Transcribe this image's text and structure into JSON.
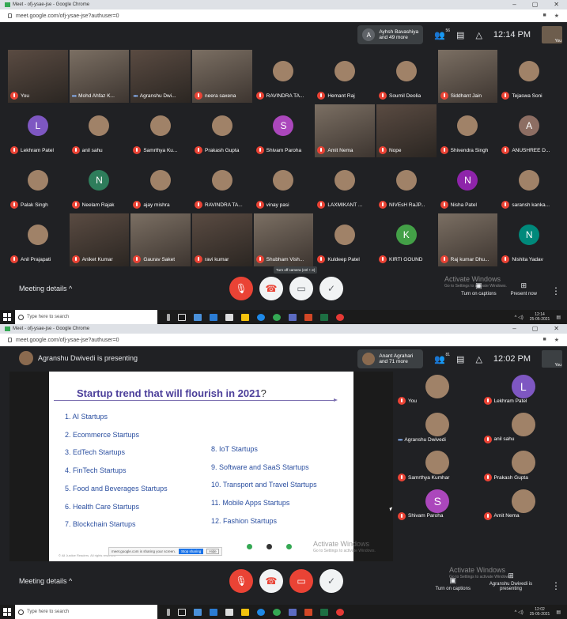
{
  "colors": {
    "meet_bg": "#202124",
    "mic_off": "#ea4335",
    "accent_blue": "#1a73e8",
    "slide_title": "#4c3f9a",
    "slide_item": "#2b4fa0"
  },
  "top": {
    "tab_title": "Meet - ofj-ysae-jse - Google Chrome",
    "url": "meet.google.com/ofj-ysae-jse?authuser=0",
    "pill_initial": "A",
    "pill_text": "Ayhsh Bavashiya and 49 more",
    "people_count": "56",
    "clock": "12:14 PM",
    "self_label": "You",
    "tiles": [
      {
        "name": "You",
        "muted": true,
        "kind": "video"
      },
      {
        "name": "Mohd Ahfaz K...",
        "muted": false,
        "kind": "video2"
      },
      {
        "name": "Agranshu Dwi...",
        "muted": false,
        "kind": "video"
      },
      {
        "name": "neera saxena",
        "muted": true,
        "kind": "video2"
      },
      {
        "name": "RAVINDRA TA...",
        "muted": true,
        "kind": "photo"
      },
      {
        "name": "Hemant Raj",
        "muted": true,
        "kind": "photo"
      },
      {
        "name": "Soumil Deolia",
        "muted": true,
        "kind": "photo"
      },
      {
        "name": "Siddhant Jain",
        "muted": true,
        "kind": "video2"
      },
      {
        "name": "Tejaswa Soni",
        "muted": true,
        "kind": "photo"
      },
      {
        "name": "Lekhram Patel",
        "muted": true,
        "initial": "L",
        "color": "#7e57c2"
      },
      {
        "name": "anil sahu",
        "muted": true,
        "kind": "photo"
      },
      {
        "name": "Samrthya Ku...",
        "muted": true,
        "kind": "photo"
      },
      {
        "name": "Prakash Gupta",
        "muted": true,
        "kind": "photo"
      },
      {
        "name": "Shivam Paroha",
        "muted": true,
        "initial": "S",
        "color": "#ab47bc"
      },
      {
        "name": "Amit Nema",
        "muted": true,
        "kind": "video2"
      },
      {
        "name": "Nope",
        "muted": true,
        "kind": "video"
      },
      {
        "name": "Shivendra Singh",
        "muted": true,
        "kind": "photo"
      },
      {
        "name": "ANUSHREE D...",
        "muted": true,
        "initial": "A",
        "color": "#8d6e63"
      },
      {
        "name": "Palak Singh",
        "muted": true,
        "kind": "photo"
      },
      {
        "name": "Neelam Rajak",
        "muted": true,
        "initial": "N",
        "color": "#2e7d5b"
      },
      {
        "name": "ajay mishra",
        "muted": true,
        "kind": "photo"
      },
      {
        "name": "RAVINDRA TA...",
        "muted": true,
        "kind": "photo"
      },
      {
        "name": "vinay pasi",
        "muted": true,
        "kind": "photo"
      },
      {
        "name": "LAXMIKANT ...",
        "muted": true,
        "kind": "photo"
      },
      {
        "name": "NIVEsH RaJP...",
        "muted": true,
        "kind": "photo"
      },
      {
        "name": "Nisha Patel",
        "muted": true,
        "initial": "N",
        "color": "#8e24aa"
      },
      {
        "name": "saransh kanka...",
        "muted": true,
        "kind": "photo"
      },
      {
        "name": "Anil Prajapati",
        "muted": true,
        "kind": "photo"
      },
      {
        "name": "Aniket Kumar",
        "muted": true,
        "kind": "video"
      },
      {
        "name": "Gaurav Saket",
        "muted": true,
        "kind": "video2"
      },
      {
        "name": "ravi kumar",
        "muted": true,
        "kind": "video"
      },
      {
        "name": "Shubham Vish...",
        "muted": true,
        "kind": "video2"
      },
      {
        "name": "Kuldeep Patel",
        "muted": true,
        "kind": "photo"
      },
      {
        "name": "KIRTI GOUND",
        "muted": true,
        "initial": "K",
        "color": "#43a047"
      },
      {
        "name": "Raj kumar Dhu...",
        "muted": true,
        "kind": "video2"
      },
      {
        "name": "Nishita Yadav",
        "muted": true,
        "initial": "N",
        "color": "#00897b"
      }
    ],
    "meeting_details": "Meeting details",
    "tooltip": "Turn off camera (ctrl + e)",
    "captions": "Turn on captions",
    "present": "Present now",
    "watermark_title": "Activate Windows",
    "watermark_sub": "Go to Settings to activate Windows.",
    "taskbar_search": "Type here to search",
    "tray_time": "12:14",
    "tray_date": "25-05-2021"
  },
  "bottom": {
    "tab_title": "Meet - ofj-ysae-jse - Google Chrome",
    "url": "meet.google.com/ofj-ysae-jse?authuser=0",
    "presenting": "Agranshu Dwivedi is presenting",
    "pill_text": "Anant Agrahari and 71 more",
    "people_count": "81",
    "clock": "12:02 PM",
    "self_label": "You",
    "slide": {
      "title": "Startup trend  that will flourish in 2021",
      "qmark": "?",
      "left_items": [
        "1. AI Startups",
        "2. Ecommerce Startups",
        "3. EdTech Startups",
        "4. FinTech Startups",
        "5. Food and Beverages Startups",
        "6. Health Care Startups",
        "7. Blockchain Startups"
      ],
      "right_items": [
        "8. IoT Startups",
        "9. Software and SaaS Startups",
        "10. Transport and Travel Startups",
        "11. Mobile Apps Startups",
        "12. Fashion Startups"
      ],
      "copyright": "© All Justice Readers. All rights reserved"
    },
    "share_text": "meet.google.com is sharing your screen.",
    "stop_sharing": "Stop sharing",
    "hide": "Hide",
    "tiles": [
      {
        "name": "You",
        "muted": true,
        "kind": "photo"
      },
      {
        "name": "Lekhram Patel",
        "muted": true,
        "initial": "L",
        "color": "#7e57c2"
      },
      {
        "name": "Agranshu Dwivedi",
        "muted": false,
        "kind": "photo"
      },
      {
        "name": "anil sahu",
        "muted": true,
        "kind": "photo"
      },
      {
        "name": "Samrthya Kumhar",
        "muted": true,
        "kind": "photo"
      },
      {
        "name": "Prakash Gupta",
        "muted": true,
        "kind": "photo"
      },
      {
        "name": "Shivam Paroha",
        "muted": true,
        "initial": "S",
        "color": "#ab47bc"
      },
      {
        "name": "Amit Nema",
        "muted": true,
        "kind": "photo"
      }
    ],
    "meeting_details": "Meeting details",
    "captions": "Turn on captions",
    "present": "Agranshu Dwivedi is presenting",
    "watermark_title": "Activate Windows",
    "watermark_sub": "Go to Settings to activate Windows.",
    "taskbar_search": "Type here to search",
    "tray_time": "12:02",
    "tray_date": "25-05-2021"
  }
}
